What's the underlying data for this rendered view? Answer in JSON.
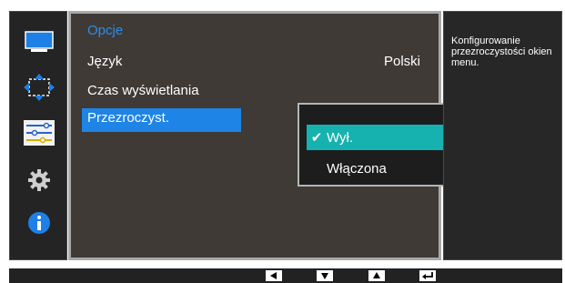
{
  "menu": {
    "title": "Opcje",
    "items": [
      {
        "label": "Język",
        "value": "Polski"
      },
      {
        "label": "Czas wyświetlania"
      },
      {
        "label": "Przezroczyst."
      }
    ]
  },
  "submenu": {
    "options": [
      "Wył.",
      "Włączona"
    ],
    "selected_index": 0,
    "check_icon": "checkmark-icon"
  },
  "info": {
    "text": "Konfigurowanie przezroczystości okien menu."
  },
  "sidebar": {
    "icons": [
      "monitor-icon",
      "resize-arrows-icon",
      "sliders-icon",
      "gear-icon",
      "info-icon"
    ],
    "active_index": 2
  },
  "bottom_bar": {
    "buttons": [
      "left-arrow-icon",
      "down-arrow-icon",
      "up-arrow-icon",
      "enter-return-icon"
    ]
  },
  "colors": {
    "title_blue": "#2d8de8",
    "highlight_blue": "#1e84e6",
    "selected_teal": "#16b2b0",
    "main_bg": "#3f3a36"
  }
}
